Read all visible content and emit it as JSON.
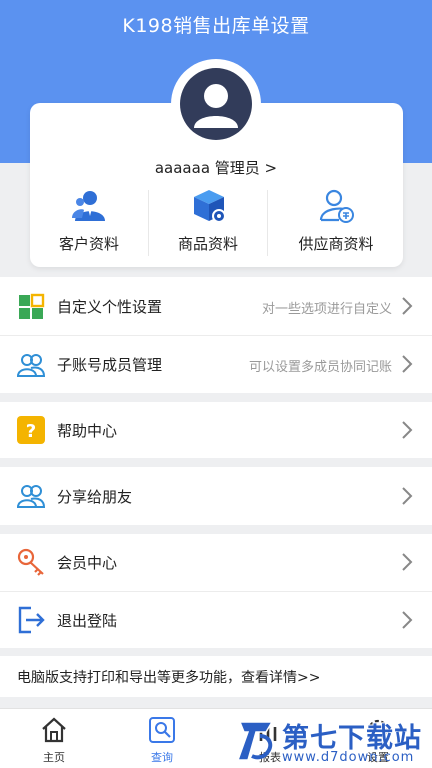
{
  "header": {
    "title": "K198销售出库单设置",
    "bg_color": "#5b92f0"
  },
  "profile": {
    "username": "aaaaaa 管理员 >",
    "avatar_icon": "user-avatar-icon"
  },
  "quick_links": [
    {
      "label": "客户资料",
      "icon": "customers-icon"
    },
    {
      "label": "商品资料",
      "icon": "product-box-icon"
    },
    {
      "label": "供应商资料",
      "icon": "supplier-icon"
    }
  ],
  "menu": [
    {
      "label": "自定义个性设置",
      "hint": "对一些选项进行自定义",
      "icon": "grid-customize-icon"
    },
    {
      "label": "子账号成员管理",
      "hint": "可以设置多成员协同记账",
      "icon": "members-icon"
    },
    {
      "label": "帮助中心",
      "hint": "",
      "icon": "help-icon"
    },
    {
      "label": "分享给朋友",
      "hint": "",
      "icon": "share-friends-icon"
    },
    {
      "label": "会员中心",
      "hint": "",
      "icon": "vip-key-icon"
    },
    {
      "label": "退出登陆",
      "hint": "",
      "icon": "logout-icon"
    }
  ],
  "promo": {
    "text": "电脑版支持打印和导出等更多功能，查看详情>>"
  },
  "tabbar": [
    {
      "label": "主页",
      "icon": "home-icon"
    },
    {
      "label": "查询",
      "icon": "query-icon"
    },
    {
      "label": "报表",
      "icon": "report-icon"
    },
    {
      "label": "设置",
      "icon": "settings-icon"
    }
  ],
  "watermark": {
    "title": "第七下载站",
    "url": "www.d7down.com"
  },
  "colors": {
    "accent": "#3a78e8",
    "help_yellow": "#f4b400",
    "vip_orange": "#e8663a"
  }
}
